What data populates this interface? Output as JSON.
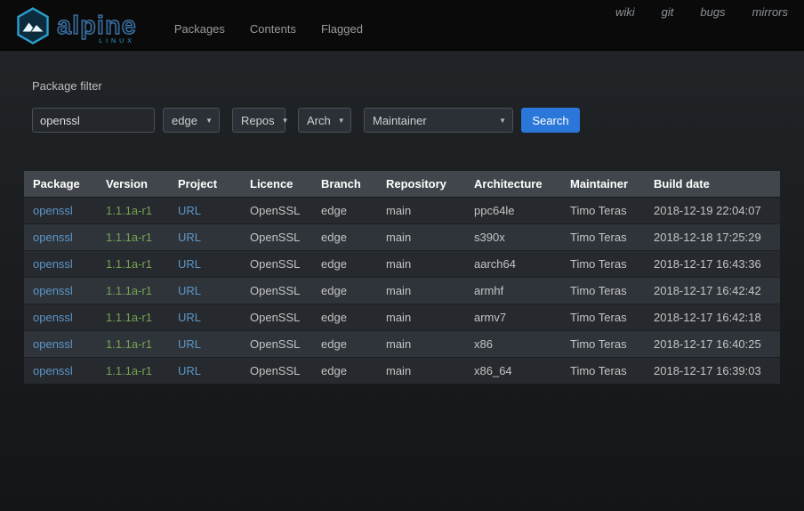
{
  "colors": {
    "link_blue": "#5d96c8",
    "version_green": "#74a253",
    "button_blue": "#2b77d9",
    "brand_teal": "#2a9fce",
    "brand_blue": "#3f7cb6"
  },
  "navbar": {
    "brand": {
      "word": "alpine",
      "sub": "LINUX"
    },
    "links": [
      {
        "label": "Packages"
      },
      {
        "label": "Contents"
      },
      {
        "label": "Flagged"
      }
    ],
    "external_links": [
      {
        "label": "wiki"
      },
      {
        "label": "git"
      },
      {
        "label": "bugs"
      },
      {
        "label": "mirrors"
      }
    ]
  },
  "filter": {
    "title": "Package filter",
    "name_value": "openssl",
    "branch_selected": "edge",
    "repo_selected": "Repos",
    "arch_selected": "Arch",
    "maintainer_selected": "Maintainer",
    "search_label": "Search"
  },
  "table": {
    "columns": [
      {
        "key": "package",
        "label": "Package",
        "type": "link"
      },
      {
        "key": "version",
        "label": "Version",
        "type": "version"
      },
      {
        "key": "project",
        "label": "Project",
        "type": "link"
      },
      {
        "key": "licence",
        "label": "Licence",
        "type": "text"
      },
      {
        "key": "branch",
        "label": "Branch",
        "type": "text"
      },
      {
        "key": "repository",
        "label": "Repository",
        "type": "text"
      },
      {
        "key": "architecture",
        "label": "Architecture",
        "type": "text"
      },
      {
        "key": "maintainer",
        "label": "Maintainer",
        "type": "text"
      },
      {
        "key": "build_date",
        "label": "Build date",
        "type": "text"
      }
    ],
    "rows": [
      {
        "package": "openssl",
        "version": "1.1.1a-r1",
        "project": "URL",
        "licence": "OpenSSL",
        "branch": "edge",
        "repository": "main",
        "architecture": "ppc64le",
        "maintainer": "Timo Teras",
        "build_date": "2018-12-19 22:04:07"
      },
      {
        "package": "openssl",
        "version": "1.1.1a-r1",
        "project": "URL",
        "licence": "OpenSSL",
        "branch": "edge",
        "repository": "main",
        "architecture": "s390x",
        "maintainer": "Timo Teras",
        "build_date": "2018-12-18 17:25:29"
      },
      {
        "package": "openssl",
        "version": "1.1.1a-r1",
        "project": "URL",
        "licence": "OpenSSL",
        "branch": "edge",
        "repository": "main",
        "architecture": "aarch64",
        "maintainer": "Timo Teras",
        "build_date": "2018-12-17 16:43:36"
      },
      {
        "package": "openssl",
        "version": "1.1.1a-r1",
        "project": "URL",
        "licence": "OpenSSL",
        "branch": "edge",
        "repository": "main",
        "architecture": "armhf",
        "maintainer": "Timo Teras",
        "build_date": "2018-12-17 16:42:42"
      },
      {
        "package": "openssl",
        "version": "1.1.1a-r1",
        "project": "URL",
        "licence": "OpenSSL",
        "branch": "edge",
        "repository": "main",
        "architecture": "armv7",
        "maintainer": "Timo Teras",
        "build_date": "2018-12-17 16:42:18"
      },
      {
        "package": "openssl",
        "version": "1.1.1a-r1",
        "project": "URL",
        "licence": "OpenSSL",
        "branch": "edge",
        "repository": "main",
        "architecture": "x86",
        "maintainer": "Timo Teras",
        "build_date": "2018-12-17 16:40:25"
      },
      {
        "package": "openssl",
        "version": "1.1.1a-r1",
        "project": "URL",
        "licence": "OpenSSL",
        "branch": "edge",
        "repository": "main",
        "architecture": "x86_64",
        "maintainer": "Timo Teras",
        "build_date": "2018-12-17 16:39:03"
      }
    ]
  }
}
